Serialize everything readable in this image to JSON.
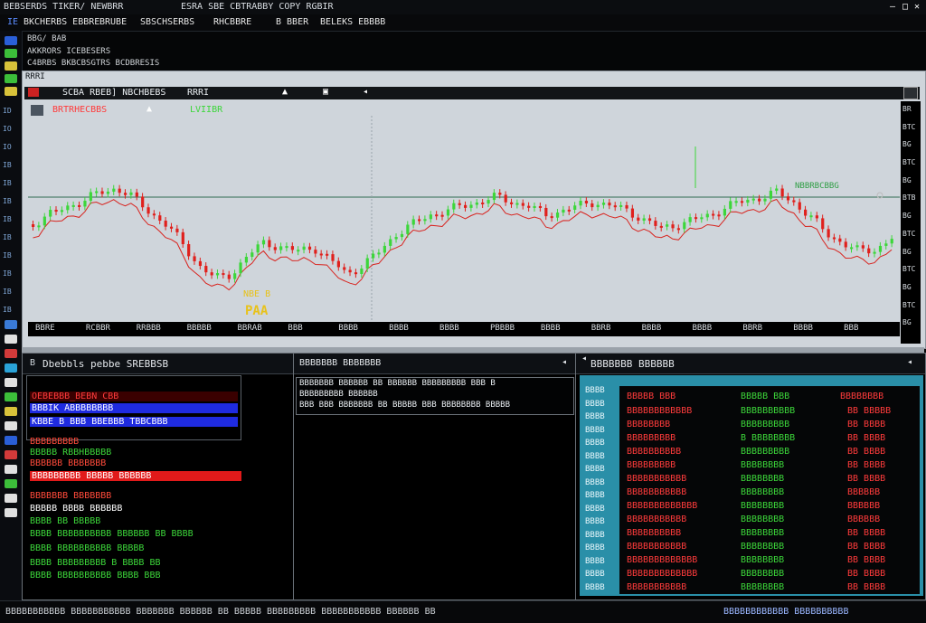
{
  "title_bar": {
    "left": "BEBSERDS  TIKER/ NEWBRR",
    "center": "ESRA SBE CBTRABBY COPY RGBIR",
    "controls": [
      "—",
      "□",
      "✕"
    ]
  },
  "menu": [
    "BKCHERBS EBBRE",
    "BRUBE",
    "SBSCHSERBS",
    "RHCBBRE",
    "B BBER",
    "BELEKS EBBBB"
  ],
  "info_lines": [
    "BBG/ BAB",
    "AKKRORS  ICEBESERS",
    "C4BRBS BKBCBSGTRS  BCDBRESIS"
  ],
  "chart": {
    "tab_label": "SCBA RBEB] NBCHBEBS",
    "tab_right": "RRRI",
    "toolbar_label_red": "BRTRHECBBS",
    "toolbar_label_green": "LVIIBR",
    "annotation_pivot": "NBE B",
    "annotation_code": "PAA",
    "annotation_right": "NBBRBCBBG",
    "x_ticks": [
      "BBRE",
      "RCBBR",
      "RRBBB",
      "BBBBB",
      "BBRAB",
      "BBB",
      "BBBB",
      "BBBB",
      "BBBB",
      "PBBBB",
      "BBBB",
      "BBRB",
      "BBBB",
      "BBBB",
      "BBRB",
      "BBBB",
      "BBB"
    ],
    "y_ticks": [
      "BR",
      "BTC",
      "BG",
      "BTC",
      "BG",
      "BTB",
      "BG",
      "BTC",
      "BG",
      "BTC",
      "BG",
      "BTC",
      "BG"
    ],
    "colors": {
      "up": "#3cd63a",
      "down": "#e0201c",
      "ma": "#d8241f"
    }
  },
  "left_panel": {
    "title": "Dbebbls pebbe SREBBSB",
    "rows": [
      {
        "text": "OEBEBBB_BEBN CBB",
        "fg": "#ff3b3b",
        "bg": "#3a0000"
      },
      {
        "text": "BBBIK  ABBBBBBBB",
        "fg": "#ffffff",
        "bg": "#1f2be0"
      },
      {
        "text": "KBBE B BBB   BBEBBB TBBCBBB",
        "fg": "#ffffff",
        "bg": "#1f2be0"
      },
      {
        "text": "BBBBBBBBB",
        "fg": "#ff4a3a",
        "bg": ""
      },
      {
        "text": "BBBBB RBBHBBBBB",
        "fg": "#3cd63a",
        "bg": ""
      },
      {
        "text": "BBBBBB BBBBBBB",
        "fg": "#ff4a3a",
        "bg": ""
      },
      {
        "text": "BBBBBBBBB  BBBBB  BBBBBB",
        "fg": "#ffffff",
        "bg": "#e11a1a"
      },
      {
        "text": "BBBBBBB  BBBBBBB",
        "fg": "#ff4a3a",
        "bg": ""
      },
      {
        "text": "BBBBB   BBBB BBBBBB",
        "fg": "#ffffff",
        "bg": ""
      },
      {
        "text": "BBBB  BB BBBBB",
        "fg": "#3cd63a",
        "bg": ""
      },
      {
        "text": "BBBB BBBBBBBBBB  BBBBBB   BB  BBBB",
        "fg": "#3cd63a",
        "bg": ""
      },
      {
        "text": "BBBB  BBBBBBBBBB  BBBBB",
        "fg": "#3cd63a",
        "bg": ""
      },
      {
        "text": "BBBB  BBBBBBBBB  B BBBB  BB",
        "fg": "#3cd63a",
        "bg": ""
      },
      {
        "text": "BBBB  BBBBBBBBBB  BBBB  BBB",
        "fg": "#3cd63a",
        "bg": ""
      }
    ]
  },
  "middle_panel": {
    "title": "BBBBBBB BBBBBBB",
    "head_row": "BBBBBBB BBBBBB BB  BBBBBB BBBBBBBBB  BBB  B",
    "sub_row": "BBBBBBBBB  BBBBBB",
    "sub_row2": "BBB BBB  BBBBBBB BB BBBBB BBB  BBBBBBBB BBBBB"
  },
  "right_panel": {
    "title": "BBBBBBB BBBBBB",
    "headers": [
      "BBBBB BBB",
      "BBBBB BBB",
      "BBBBBBBB"
    ],
    "sidebar": [
      "BBBB",
      "BBBB",
      "BBBB",
      "BBBB",
      "BBBB",
      "BBBB",
      "BBBB",
      "BBBB",
      "BBBB",
      "BBBB",
      "BBBB",
      "BBBB",
      "BBBB",
      "BBBB",
      "BBBB",
      "BBBB"
    ],
    "rows": [
      [
        "BBBBBBBBBBBB",
        "BBBBBBBBBB",
        "BB BBBBB"
      ],
      [
        "BBBBBBBB",
        "BBBBBBBBB",
        "BB BBBB"
      ],
      [
        "BBBBBBBBB",
        "B BBBBBBBB",
        "BB BBBB"
      ],
      [
        "BBBBBBBBBB",
        "BBBBBBBBB",
        "BB BBBB"
      ],
      [
        "BBBBBBBBB",
        "BBBBBBBB",
        "BB BBBB"
      ],
      [
        "BBBBBBBBBBB",
        "BBBBBBBB",
        "BB BBBB"
      ],
      [
        "BBBBBBBBBBB",
        "BBBBBBBB",
        "BBBBBB"
      ],
      [
        "BBBBBBBBBBBBB",
        "BBBBBBBB",
        "BBBBBB"
      ],
      [
        "BBBBBBBBBBB",
        "BBBBBBBB",
        "BBBBBB"
      ],
      [
        "BBBBBBBBBB",
        "BBBBBBBB",
        "BB BBBB"
      ],
      [
        "BBBBBBBBBBB",
        "BBBBBBBB",
        "BB BBBB"
      ],
      [
        "BBBBBBBBBBBBB",
        "BBBBBBBB",
        "BB BBBB"
      ],
      [
        "BBBBBBBBBBBBB",
        "BBBBBBBB",
        "BB BBBB"
      ],
      [
        "BBBBBBBBBBB",
        "BBBBBBBB",
        "BB BBBB"
      ]
    ]
  },
  "status_bar": {
    "left": "BBBBBBBBBBB BBBBBBBBBBB BBBBBBB BBBBBB BB BBBBB BBBBBBBBB BBBBBBBBBBB BBBBBB BB",
    "right": "BBBBBBBBBBBB BBBBBBBBBB"
  }
}
